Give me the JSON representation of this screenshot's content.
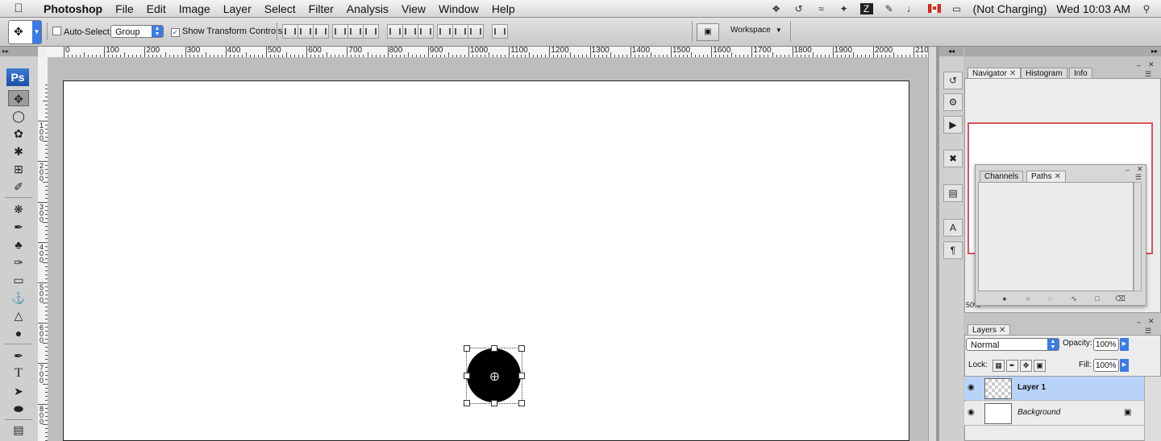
{
  "menubar": {
    "items": [
      "Photoshop",
      "File",
      "Edit",
      "Image",
      "Layer",
      "Select",
      "Filter",
      "Analysis",
      "View",
      "Window",
      "Help"
    ],
    "status": {
      "battery": "(Not Charging)",
      "clock": "Wed 10:03 AM"
    }
  },
  "options": {
    "auto_select_label": "Auto-Select:",
    "auto_select_value": "Group",
    "show_transform_label": "Show Transform Controls",
    "workspace_label": "Workspace"
  },
  "tools": {
    "logo": "Ps"
  },
  "ruler": {
    "h_labels": [
      "0",
      "100",
      "200",
      "300",
      "400",
      "500",
      "600",
      "700",
      "800",
      "900",
      "1000",
      "1100",
      "1200",
      "1300",
      "1400",
      "1500",
      "1600",
      "1700",
      "1800",
      "1900",
      "2000",
      "210"
    ],
    "v_labels": [
      "100",
      "200",
      "300",
      "400",
      "500",
      "600",
      "700",
      "800"
    ]
  },
  "navigator": {
    "tabs": [
      "Navigator",
      "Histogram",
      "Info"
    ],
    "zoom": "50%"
  },
  "channels": {
    "tabs": [
      "Channels",
      "Paths"
    ]
  },
  "layers": {
    "tab": "Layers",
    "blend_mode": "Normal",
    "opacity_label": "Opacity:",
    "opacity_value": "100%",
    "lock_label": "Lock:",
    "fill_label": "Fill:",
    "fill_value": "100%",
    "rows": [
      {
        "name": "Layer 1",
        "selected": true
      },
      {
        "name": "Background",
        "selected": false
      }
    ]
  }
}
